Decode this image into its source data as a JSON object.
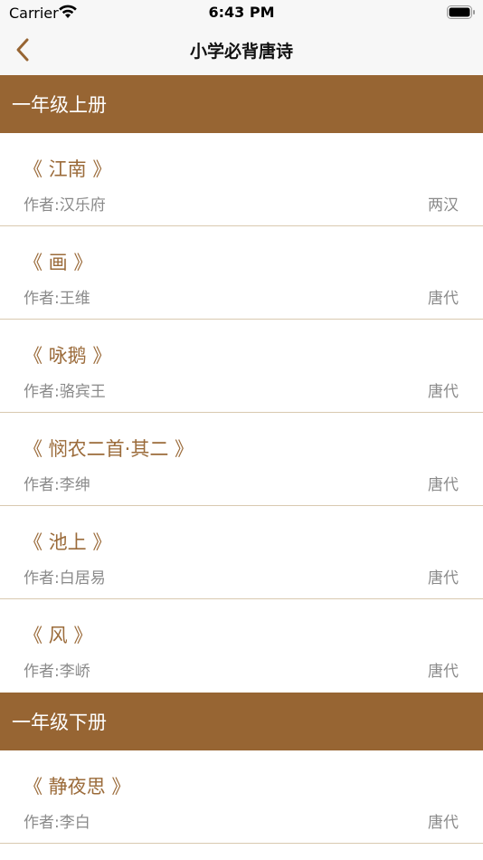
{
  "status_bar": {
    "carrier": "Carrier",
    "time": "6:43 PM"
  },
  "nav": {
    "title": "小学必背唐诗",
    "back_icon": "chevron-left-icon"
  },
  "colors": {
    "accent": "#976533",
    "title_text": "#9b6b3a",
    "separator": "#d9c9b0",
    "meta_text": "#8a8a8a"
  },
  "sections": [
    {
      "title": "一年级上册",
      "poems": [
        {
          "title": "《 江南 》",
          "author": "作者:汉乐府",
          "dynasty": "两汉"
        },
        {
          "title": "《 画 》",
          "author": "作者:王维",
          "dynasty": "唐代"
        },
        {
          "title": "《 咏鹅 》",
          "author": "作者:骆宾王",
          "dynasty": "唐代"
        },
        {
          "title": "《 悯农二首·其二 》",
          "author": "作者:李绅",
          "dynasty": "唐代"
        },
        {
          "title": "《 池上 》",
          "author": "作者:白居易",
          "dynasty": "唐代"
        },
        {
          "title": "《 风 》",
          "author": "作者:李峤",
          "dynasty": "唐代"
        }
      ]
    },
    {
      "title": "一年级下册",
      "poems": [
        {
          "title": "《 静夜思 》",
          "author": "作者:李白",
          "dynasty": "唐代"
        }
      ]
    }
  ]
}
